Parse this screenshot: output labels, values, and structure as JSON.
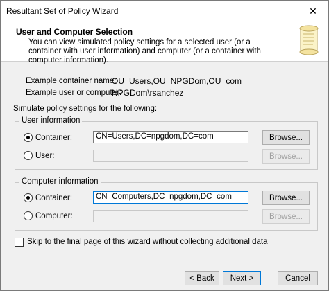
{
  "window": {
    "title": "Resultant Set of Policy Wizard",
    "close_glyph": "✕"
  },
  "header": {
    "title": "User and Computer Selection",
    "description": "You can view simulated policy settings for a selected user (or a container with user information) and computer (or a container with computer information)."
  },
  "examples": [
    {
      "label": "Example container name:",
      "value": "OU=Users,OU=NPGDom,OU=com"
    },
    {
      "label": "Example user or computer:",
      "value": "NPGDom\\rsanchez"
    }
  ],
  "simulate_label": "Simulate policy settings for the following:",
  "user_info": {
    "group_title": "User information",
    "container_label": "Container:",
    "container_value": "CN=Users,DC=npgdom,DC=com",
    "user_label": "User:",
    "user_value": "",
    "browse_label": "Browse..."
  },
  "computer_info": {
    "group_title": "Computer information",
    "container_label": "Container:",
    "container_value": "CN=Computers,DC=npgdom,DC=com",
    "computer_label": "Computer:",
    "computer_value": "",
    "browse_label": "Browse..."
  },
  "skip_label": "Skip to the final page of this wizard without collecting additional data",
  "nav": {
    "back_label": "< Back",
    "next_label": "Next >",
    "cancel_label": "Cancel"
  }
}
